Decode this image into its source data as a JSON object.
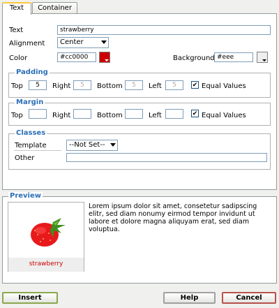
{
  "tabs": [
    {
      "label": "Text",
      "active": true
    },
    {
      "label": "Container",
      "active": false
    }
  ],
  "text_row": {
    "label": "Text",
    "value": "strawberry"
  },
  "alignment": {
    "label": "Alignment",
    "value": "Center"
  },
  "color": {
    "label": "Color",
    "value": "#cc0000",
    "swatch": "#cc0000"
  },
  "background": {
    "label": "Background",
    "value": "#eee"
  },
  "padding": {
    "legend": "Padding",
    "top_label": "Top",
    "top_value": "5",
    "right_label": "Right",
    "right_value": "5",
    "bottom_label": "Bottom",
    "bottom_value": "5",
    "left_label": "Left",
    "left_value": "5",
    "equal_label": "Equal Values"
  },
  "margin": {
    "legend": "Margin",
    "top_label": "Top",
    "right_label": "Right",
    "bottom_label": "Bottom",
    "left_label": "Left",
    "equal_label": "Equal Values"
  },
  "classes": {
    "legend": "Classes",
    "template_label": "Template",
    "template_value": "--Not Set--",
    "other_label": "Other"
  },
  "preview": {
    "legend": "Preview",
    "caption": "strawberry",
    "text": "Lorem ipsum dolor sit amet, consetetur sadipscing elitr, sed diam nonumy eirmod tempor invidunt ut labore et dolore magna aliquyam erat, sed diam voluptua."
  },
  "buttons": {
    "insert": "Insert",
    "help": "Help",
    "cancel": "Cancel"
  },
  "colors": {
    "accent_legend": "#2b6fb6",
    "caption_text": "#cc0000",
    "insert_border": "#8aa74e",
    "cancel_border": "#b8514c"
  }
}
